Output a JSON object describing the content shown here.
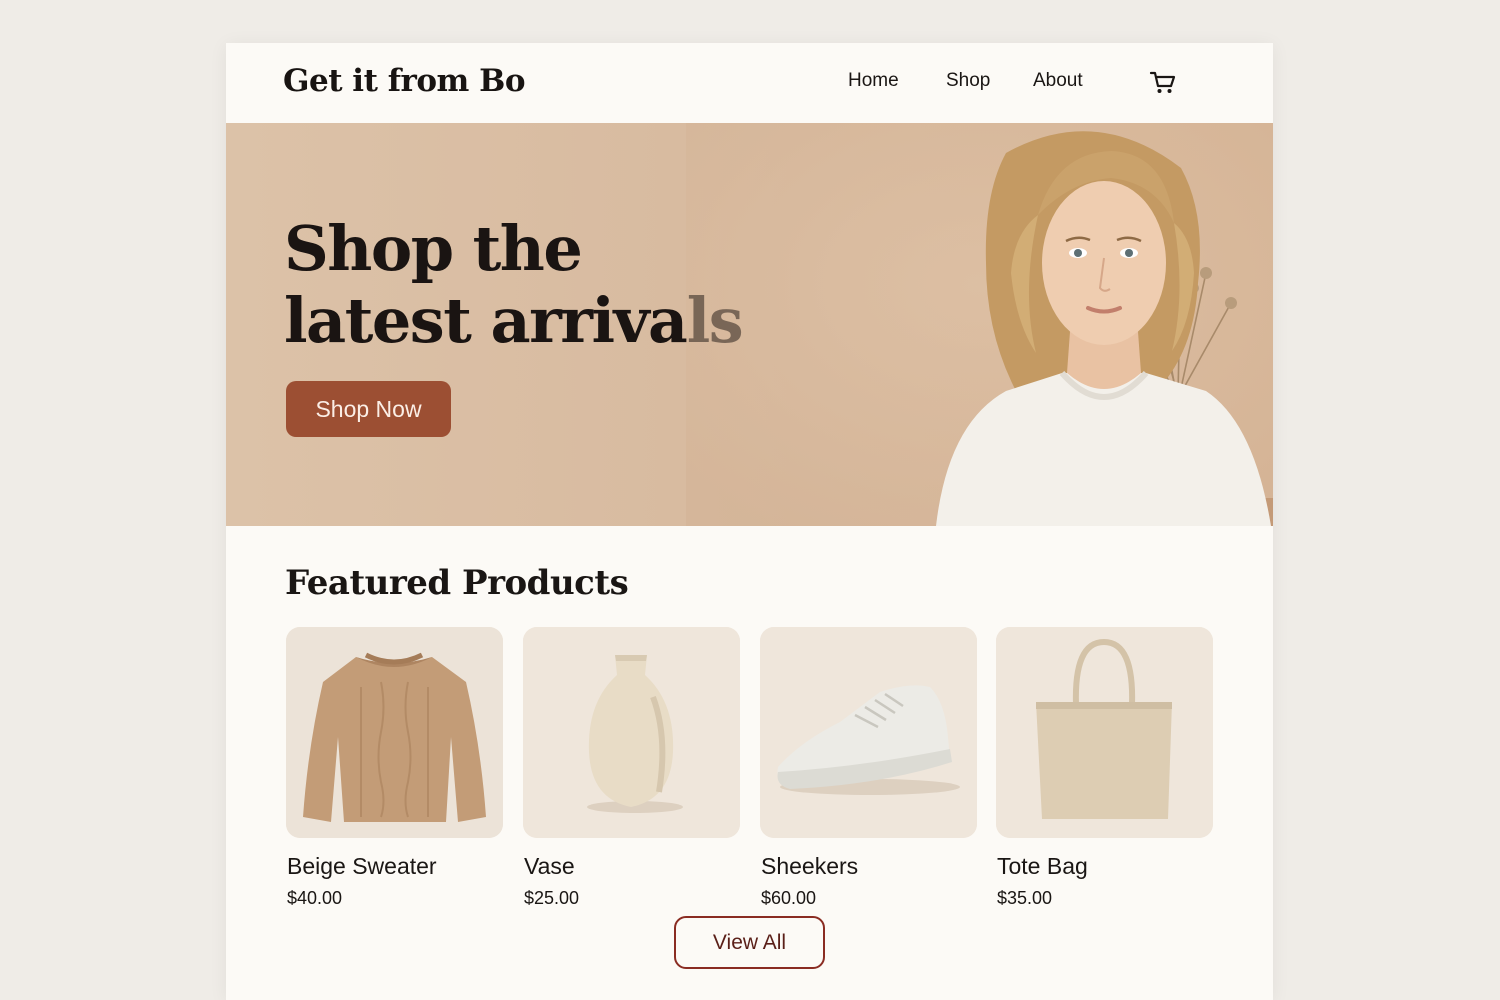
{
  "header": {
    "brand": "Get it from Bo",
    "nav": [
      {
        "label": "Home"
      },
      {
        "label": "Shop"
      },
      {
        "label": "About"
      }
    ],
    "cart_icon": "shopping-cart-icon"
  },
  "hero": {
    "title": "Shop the\nlatest arrivals",
    "cta_label": "Shop Now",
    "image": "woman-in-white-tshirt-with-vase-photo"
  },
  "featured": {
    "title": "Featured Products",
    "products": [
      {
        "name": "Beige Sweater",
        "price": "$40.00",
        "image": "beige-sweater-photo"
      },
      {
        "name": "Vase",
        "price": "$25.00",
        "image": "cream-vase-photo"
      },
      {
        "name": "Sheekers",
        "price": "$60.00",
        "image": "white-sneaker-photo"
      },
      {
        "name": "Tote Bag",
        "price": "$35.00",
        "image": "canvas-tote-bag-photo"
      }
    ],
    "view_all_label": "View All"
  },
  "colors": {
    "accent": "#9c4f33",
    "outline": "#8a2c22",
    "hero_bg": "#d7b99e",
    "page_bg": "#fcfaf6"
  }
}
